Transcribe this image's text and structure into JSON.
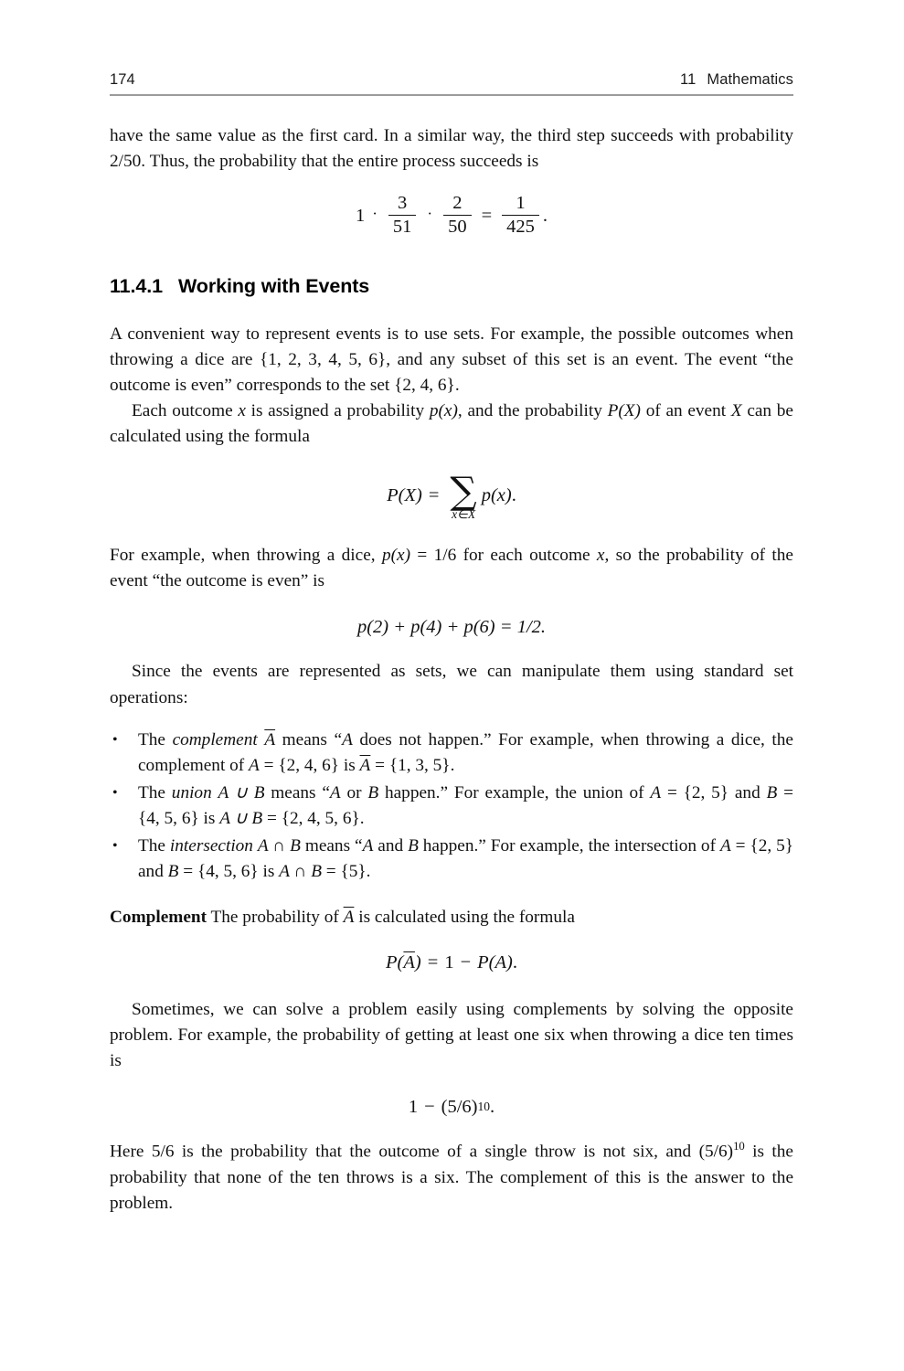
{
  "running_head": {
    "page_number": "174",
    "chapter_number": "11",
    "chapter_title": "Mathematics"
  },
  "section": {
    "number": "11.4.1",
    "title": "Working with Events"
  },
  "paragraphs": {
    "p_intro_line1": "have the same value as the first card. In a similar way, the third step succeeds with",
    "p_intro_line2": "probability 2/50. Thus, the probability that the entire process succeeds is",
    "p_sets_1": "A convenient way to represent events is to use sets. For example, the possible outcomes when throwing a dice are ",
    "p_sets_set1": "{1, 2, 3, 4, 5, 6}",
    "p_sets_2": ", and any subset of this set is an event. The event “the outcome is even” corresponds to the set ",
    "p_sets_set2": "{2, 4, 6}",
    "p_sets_3": ".",
    "p_outcome_1": "Each outcome ",
    "p_outcome_x": "x",
    "p_outcome_2": " is assigned a probability ",
    "p_outcome_px": "p(x)",
    "p_outcome_3": ", and the probability ",
    "p_outcome_PX": "P(X)",
    "p_outcome_4": " of an event ",
    "p_outcome_X": "X",
    "p_outcome_5": " can be calculated using the formula",
    "p_dice_1": "For example, when throwing a dice, ",
    "p_dice_px": "p(x)",
    "p_dice_eq": " = ",
    "p_dice_val": "1/6",
    "p_dice_2": " for each outcome ",
    "p_dice_x": "x",
    "p_dice_3": ", so the probability of the event “the outcome is even” is",
    "p_since": "Since the events are represented as sets, we can manipulate them using standard set operations:",
    "p_complement_label": "Complement",
    "p_complement_1": " The probability of ",
    "p_complement_A": "A",
    "p_complement_2": " is calculated using the formula",
    "p_sometimes": "Sometimes, we can solve a problem easily using complements by solving the opposite problem. For example, the probability of getting at least one six when throwing a dice ten times is",
    "p_here_1": "Here 5/6 is the probability that the outcome of a single throw is not six, and (5/6)",
    "p_here_exp": "10",
    "p_here_2": " is the probability that none of the ten throws is a six. The complement of this is the answer to the problem."
  },
  "equations": {
    "eq1": {
      "lead": "1",
      "cdot": "·",
      "f1_num": "3",
      "f1_den": "51",
      "f2_num": "2",
      "f2_den": "50",
      "equals": "=",
      "f3_num": "1",
      "f3_den": "425",
      "period": "."
    },
    "eq2": {
      "lhs": "P(X)",
      "equals": "=",
      "sigma": "∑",
      "limit": "x∈X",
      "rhs": "p(x)",
      "period": "."
    },
    "eq3": {
      "text": "p(2) + p(4) + p(6) = 1/2."
    },
    "eq4": {
      "lhs_open": "P(",
      "lhs_A": "A",
      "lhs_close": ")",
      "equals": "=",
      "one": "1",
      "minus": "−",
      "rhs": "P(A)",
      "period": "."
    },
    "eq5": {
      "one": "1",
      "minus": "−",
      "base": "(5/6)",
      "exp": "10",
      "period": "."
    }
  },
  "bullets": [
    {
      "marker": "•",
      "t1": "The ",
      "em": "complement",
      "t2": " ",
      "var_A": "A",
      "t3": " means “",
      "var_A2": "A",
      "t4": " does not happen.” For example, when throwing a dice, the complement of ",
      "var_A3": "A",
      "t5": " = ",
      "set1": "{2, 4, 6}",
      "t6": " is ",
      "var_A4": "A",
      "t7": " = ",
      "set2": "{1, 3, 5}",
      "t8": "."
    },
    {
      "marker": "•",
      "t1": "The ",
      "em": "union",
      "t2": " ",
      "expr": "A ∪ B",
      "t3": " means “",
      "var_A": "A",
      "t4": " or ",
      "var_B": "B",
      "t5": " happen.” For example, the union of ",
      "var_A2": "A",
      "t6": " = ",
      "set1": "{2, 5}",
      "t7": " and ",
      "var_B2": "B",
      "t8": " = ",
      "set2": "{4, 5, 6}",
      "t9": " is ",
      "expr2": "A ∪ B",
      "t10": " = ",
      "set3": "{2, 4, 5, 6}",
      "t11": "."
    },
    {
      "marker": "•",
      "t1": "The ",
      "em": "intersection",
      "t2": " ",
      "expr": "A ∩ B",
      "t3": " means “",
      "var_A": "A",
      "t4": " and ",
      "var_B": "B",
      "t5": " happen.” For example, the intersection of ",
      "var_A2": "A",
      "t6": " = ",
      "set1": "{2, 5}",
      "t7": " and ",
      "var_B2": "B",
      "t8": " = ",
      "set2": "{4, 5, 6}",
      "t9": " is ",
      "expr2": "A ∩ B",
      "t10": " = ",
      "set3": "{5}",
      "t11": "."
    }
  ]
}
